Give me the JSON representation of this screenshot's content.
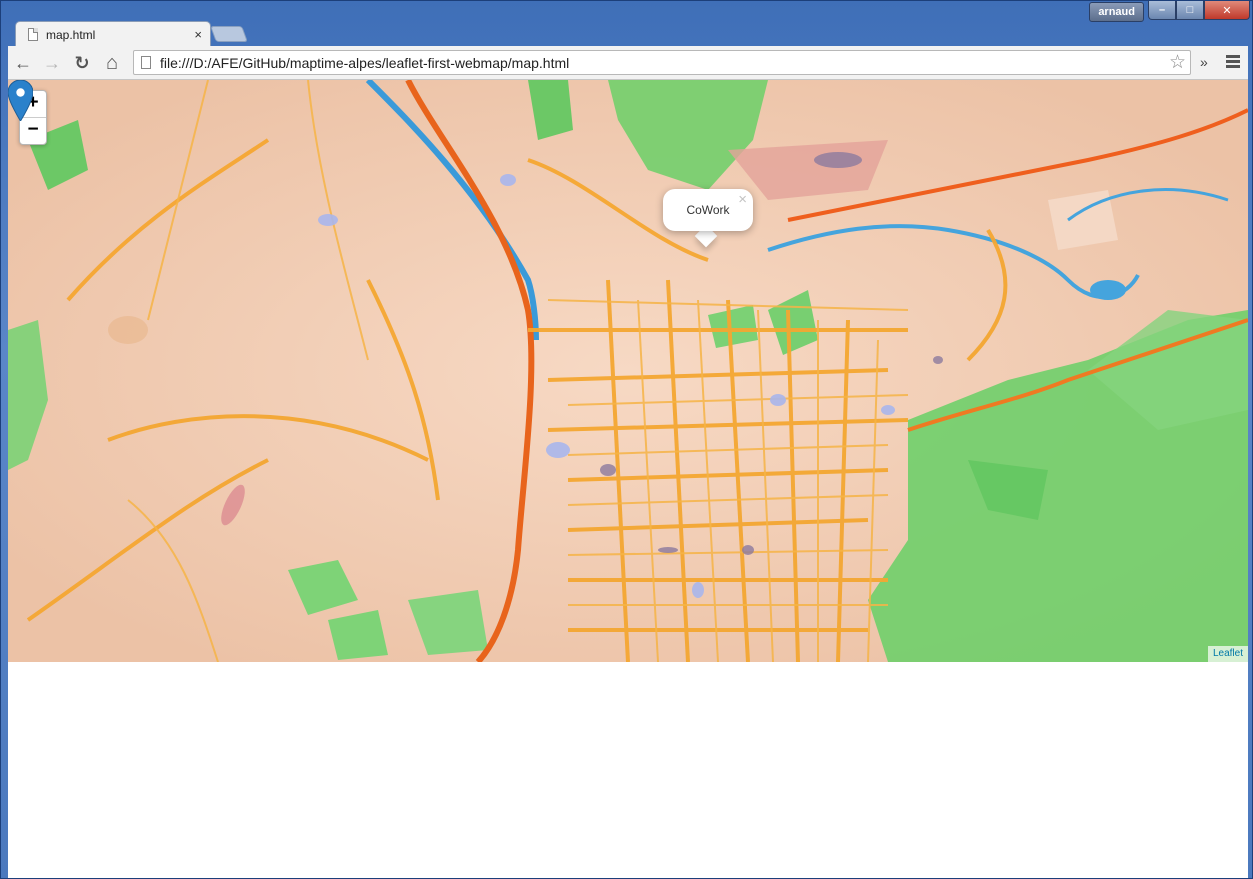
{
  "window": {
    "user": "arnaud",
    "minimize": "–",
    "maximize": "□",
    "close": "✕"
  },
  "tab": {
    "title": "map.html",
    "close": "×"
  },
  "toolbar": {
    "back": "←",
    "forward": "→",
    "reload": "↻",
    "home": "⌂",
    "url": "file:///D:/AFE/GitHub/maptime-alpes/leaflet-first-webmap/map.html",
    "star": "☆",
    "more": "»"
  },
  "map": {
    "zoom_in": "+",
    "zoom_out": "−",
    "popup_text": "CoWork",
    "popup_close": "×",
    "attribution": "Leaflet",
    "colors": {
      "land": "#f1d2bd",
      "parks": "#6fcf6a",
      "roads": "#f4a732",
      "highway": "#e8641c",
      "water": "#3a9ad9",
      "marker": "#2a81cb"
    }
  }
}
